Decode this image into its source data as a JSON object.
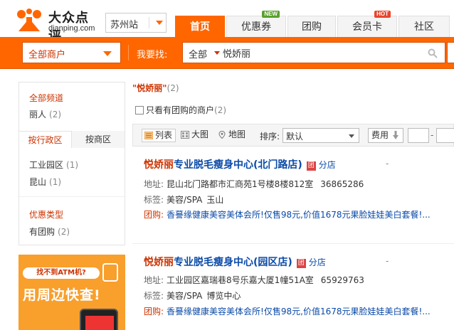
{
  "header": {
    "logo_cn": "大众点评",
    "logo_en": "dianping.com",
    "city": "苏州站",
    "tabs": [
      {
        "label": "首页",
        "active": true,
        "badge": ""
      },
      {
        "label": "优惠券",
        "active": false,
        "badge": "NEW"
      },
      {
        "label": "团购",
        "active": false,
        "badge": ""
      },
      {
        "label": "会员卡",
        "active": false,
        "badge": "HOT"
      },
      {
        "label": "社区",
        "active": false,
        "badge": ""
      }
    ],
    "colors": {
      "brand": "#ff6600",
      "new_badge": "#5aa02c",
      "hot_badge": "#e8452c"
    }
  },
  "search": {
    "category": "全部商户",
    "label": "我要找:",
    "scope": "全部",
    "query": "悦娇丽"
  },
  "sidebar": {
    "channel_title": "全部频道",
    "channel_item": {
      "label": "丽人",
      "count": "(2)"
    },
    "region_tabs": [
      "按行政区",
      "按商区"
    ],
    "regions": [
      {
        "label": "工业园区",
        "count": "(1)"
      },
      {
        "label": "昆山",
        "count": "(1)"
      }
    ],
    "offer_title": "优惠类型",
    "offer_item": {
      "label": "有团购",
      "count": "(2)"
    },
    "promo": {
      "pill": "找不到ATM机?",
      "big": "用周边快查!"
    }
  },
  "results": {
    "query_quoted": "\"悦娇丽\"",
    "count": "(2)",
    "only_group_label": "只看有团购的商户",
    "only_group_count": "(2)",
    "views": [
      "列表",
      "大图",
      "地图"
    ],
    "sort_label": "排序:",
    "sort_value": "默认",
    "fee_label": "费用",
    "shops": [
      {
        "name_hl": "悦娇丽",
        "name_rest": "专业脱毛瘦身中心(北门路店)",
        "tuan": "团",
        "branch": "分店",
        "dash": "-",
        "addr_label": "地址:",
        "address": "昆山北门路都市汇商苑1号楼8楼812室",
        "phone": "36865286",
        "tags_label": "标签:",
        "tags": [
          "美容/SPA",
          "玉山"
        ],
        "deal_label": "团购:",
        "deal": "香謩缘健康美容美体会所!仅售98元,价值1678元果脸娃娃美白套餐!..."
      },
      {
        "name_hl": "悦娇丽",
        "name_rest": "专业脱毛瘦身中心(园区店)",
        "tuan": "团",
        "branch": "分店",
        "dash": "-",
        "addr_label": "地址:",
        "address": "工业园区嘉瑞巷8号乐嘉大厦1幢51A室",
        "phone": "65929763",
        "tags_label": "标签:",
        "tags": [
          "美容/SPA",
          "博览中心"
        ],
        "deal_label": "团购:",
        "deal": "香謩缘健康美容美体会所!仅售98元,价值1678元果脸娃娃美白套餐!..."
      }
    ]
  }
}
